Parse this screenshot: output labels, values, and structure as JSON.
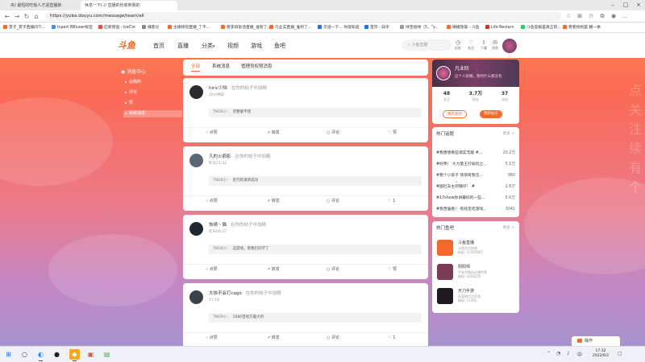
{
  "browser": {
    "tabs": [
      {
        "label": "央/ 最短的吃饭人才逼直播斯"
      },
      {
        "label": "休息一下(:// 直播的份收到我的"
      }
    ],
    "url": "https://yuba.douyu.com/message/team/all",
    "bookmarks": [
      "赏子_赏子直播间?!...",
      "Inpert B和user标签",
      "应新频道 - IceCor",
      "播客论",
      "主播榜何直播_了不...",
      "卷李四饭话直播_准到了...",
      "凡业实直播_准到了...",
      "贝道一下... 你就知道",
      "首页 - 知乎",
      "绿宝指绿（5，\"y...",
      "微播放操 - 斗鱼",
      "Life Restarn",
      "斗鱼答报是真正的...",
      "卷卷拐拐是 翻一季"
    ]
  },
  "header": {
    "logo": "斗鱼",
    "nav": [
      "首页",
      "直播",
      "分类",
      "视频",
      "游戏",
      "鱼吧"
    ],
    "search_placeholder": "斗鱼直播",
    "icons": [
      {
        "label": "历史"
      },
      {
        "label": "关注"
      },
      {
        "label": "下载"
      },
      {
        "label": "消息"
      }
    ]
  },
  "left_nav": {
    "title": "消息中心",
    "items": [
      "@我的",
      "评论",
      "赞",
      "系统消息"
    ],
    "active_index": 3
  },
  "center": {
    "tabs": [
      "全部",
      "系统消息",
      "管理员权限消息"
    ],
    "active_tab": 0,
    "cards": [
      {
        "name": "hiric少陆",
        "action": "在你的帖子中加精",
        "time": "19分钟前",
        "quote_prefix": "TNDB小：",
        "quote": "迟整版不错",
        "avatar_color": "#2b2b2b",
        "comment_count": "",
        "like_count": "赞"
      },
      {
        "name": "凡的火箭影",
        "action": "在你的帖子中加精",
        "time": "昨天21:32",
        "quote_prefix": "TNDB小：",
        "quote": "史冗的请求成功",
        "avatar_color": "#5b6675",
        "comment_count": "",
        "like_count": "1"
      },
      {
        "name": "恢绩丶猫",
        "action": "在你的帖子中加精",
        "time": "昨天09:37",
        "quote_prefix": "TNDB小：",
        "quote": "这游戏，帮我们同学了",
        "avatar_color": "#1f2830",
        "comment_count": "评论",
        "like_count": "赞"
      },
      {
        "name": "大侠不会打cago",
        "action": "在你的帖子中加精",
        "time": "17:18",
        "quote_prefix": "TNDB小：",
        "quote": "1086百地方最大的",
        "avatar_color": "#3a4148",
        "comment_count": "",
        "like_count": "1"
      }
    ],
    "actions": {
      "report": "点赞",
      "forward": "转发",
      "comment": "评论",
      "like": "赞"
    }
  },
  "profile": {
    "name": "凡业阶",
    "desc": "这个人很懒，暂时什么都没有",
    "stats": [
      {
        "n": "48",
        "l": "关注"
      },
      {
        "n": "3.7万",
        "l": "粉丝"
      },
      {
        "n": "37",
        "l": "动态"
      }
    ],
    "btn_outline": "我的鱼吧",
    "btn_fill": "我的帖子"
  },
  "hot_topics": {
    "title": "热门话题",
    "more": "更多 >",
    "items": [
      {
        "label": "#我唐想看些调实无敌 #...",
        "value": "20.2万"
      },
      {
        "label": "#好笑！ 大力量王打偷玩之...",
        "value": "5.1万"
      },
      {
        "label": "#我个小孩子 快快有我见...",
        "value": "980"
      },
      {
        "label": "#国社夫主的锦仔！ #",
        "value": "2.6万"
      },
      {
        "label": "#17show你讲最好的一些...",
        "value": "5.6万"
      },
      {
        "label": "#我苦逼看！ 有找见吃游戏...",
        "value": "3041"
      }
    ]
  },
  "hot_bars": {
    "title": "热门鱼吧",
    "more": "更多 >",
    "items": [
      {
        "name": "斗鱼直播",
        "d1": "斗鱼官方鱼吧",
        "d2": "粉丝: 15305607",
        "color": "#f5692c"
      },
      {
        "name": "阴阳师",
        "d1": "平安京和风幻想世界",
        "d2": "粉丝: 1059255",
        "color": "#7b3b52"
      },
      {
        "name": "天刀手游",
        "d1": "天涯明月刀手游",
        "d2": "粉丝: 11502",
        "color": "#1e1a1e"
      }
    ]
  },
  "float_button": "操作",
  "taskbar": {
    "time": "17:32",
    "date": "2022/6/2"
  }
}
